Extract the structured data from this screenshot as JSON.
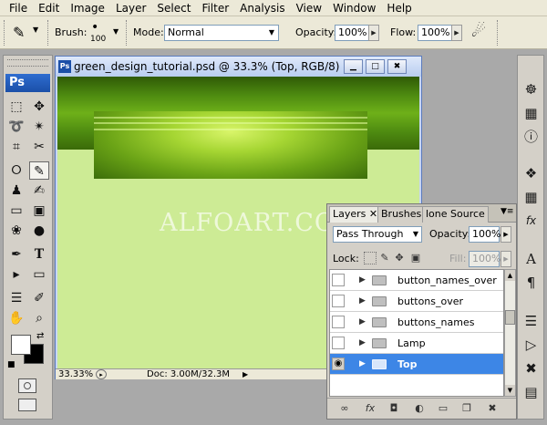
{
  "menu": [
    "File",
    "Edit",
    "Image",
    "Layer",
    "Select",
    "Filter",
    "Analysis",
    "View",
    "Window",
    "Help"
  ],
  "options_bar": {
    "brush_label": "Brush:",
    "brush_size": "100",
    "mode_label": "Mode:",
    "mode_value": "Normal",
    "opacity_label": "Opacity:",
    "opacity_value": "100%",
    "flow_label": "Flow:",
    "flow_value": "100%"
  },
  "tool_panel": {
    "logo": "Ps"
  },
  "document": {
    "title": "green_design_tutorial.psd @ 33.3% (Top, RGB/8)",
    "watermark": "ALFOART.COM",
    "zoom": "33.33%",
    "doc_size": "Doc: 3.00M/32.3M"
  },
  "layers_panel": {
    "tabs": [
      "Layers",
      "Brushes",
      "lone Source"
    ],
    "active_tab": "Layers",
    "blend_mode": "Pass Through",
    "opacity_label": "Opacity:",
    "opacity_value": "100%",
    "lock_label": "Lock:",
    "fill_label": "Fill:",
    "fill_value": "100%",
    "layers": [
      {
        "name": "button_names_over",
        "visible": false,
        "selected": false
      },
      {
        "name": "buttons_over",
        "visible": false,
        "selected": false
      },
      {
        "name": "buttons_names",
        "visible": false,
        "selected": false
      },
      {
        "name": "Lamp",
        "visible": false,
        "selected": false
      },
      {
        "name": "Top",
        "visible": true,
        "selected": true
      }
    ]
  },
  "colors": {
    "canvas_bg": "#cdeb95",
    "selection": "#3d86e6",
    "header_green": "#4d8a10"
  }
}
